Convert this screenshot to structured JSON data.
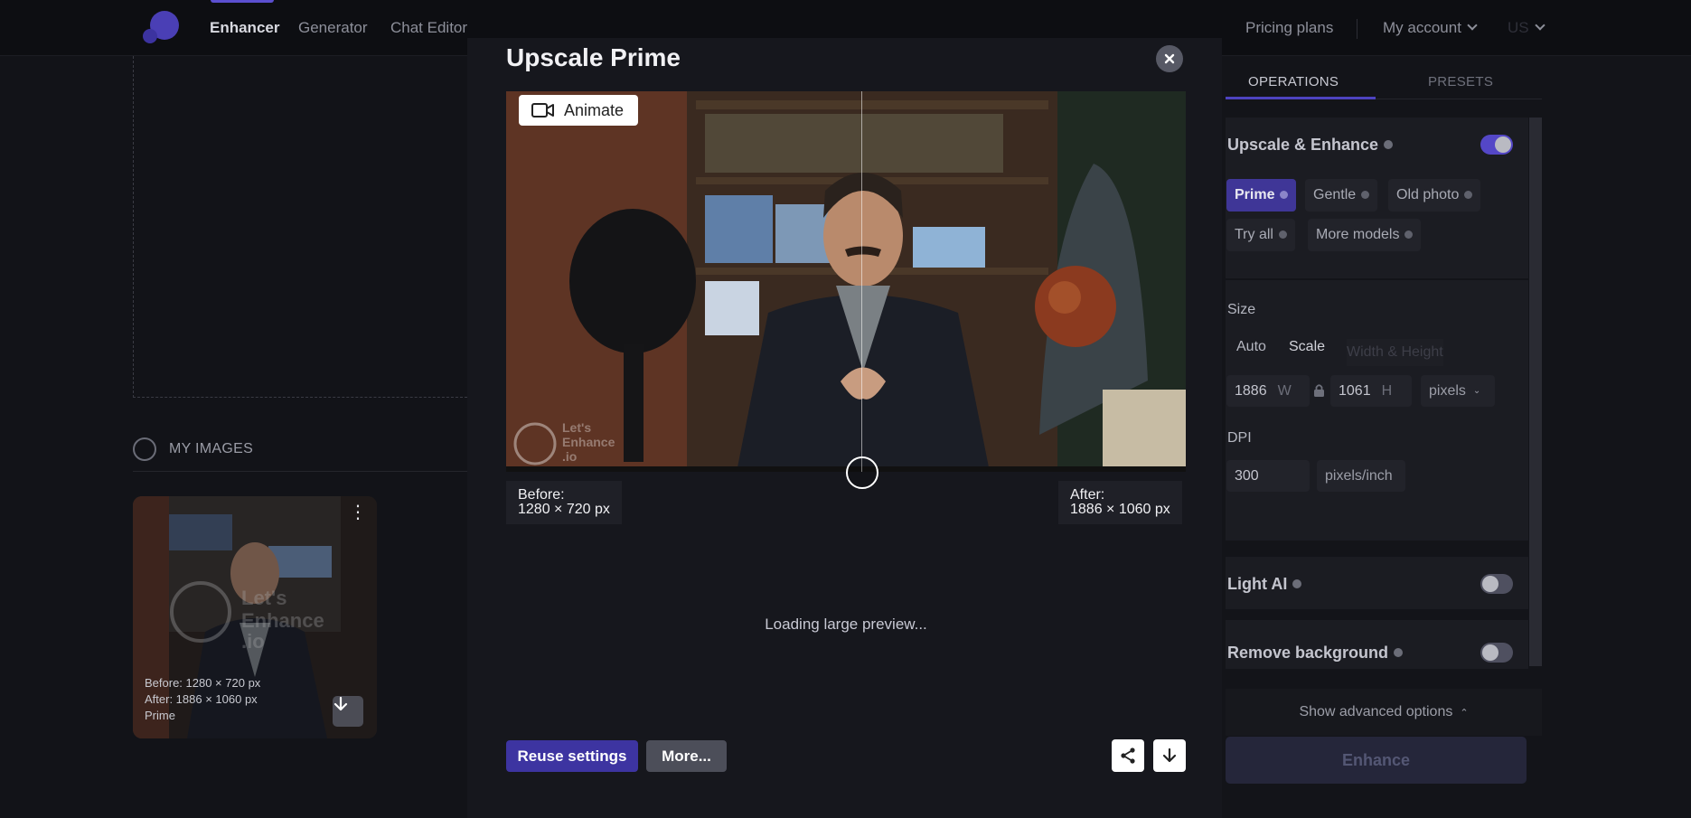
{
  "nav": {
    "items": [
      {
        "label": "Enhancer"
      },
      {
        "label": "Generator"
      },
      {
        "label": "Chat Editor"
      }
    ],
    "pricing": "Pricing plans",
    "account": "My account",
    "lang": "US"
  },
  "sidebar": {
    "my_images": "MY IMAGES",
    "thumb": {
      "before": "Before: 1280 × 720 px",
      "after": "After:   1886 × 1060 px",
      "model": "Prime"
    }
  },
  "modal": {
    "title": "Upscale Prime",
    "animate": "Animate",
    "watermark_l1": "Let's",
    "watermark_l2": "Enhance",
    "watermark_l3": ".io",
    "before_label": "Before:",
    "before_dims": "1280 × 720 px",
    "after_label": "After:",
    "after_dims": "1886 × 1060 px",
    "loading": "Loading large preview...",
    "reuse": "Reuse settings",
    "more": "More..."
  },
  "panel": {
    "tabs": [
      {
        "label": "OPERATIONS"
      },
      {
        "label": "PRESETS"
      }
    ],
    "upscale": {
      "title": "Upscale & Enhance",
      "enabled": true,
      "models": [
        {
          "label": "Prime",
          "active": true
        },
        {
          "label": "Gentle",
          "active": false
        },
        {
          "label": "Old photo",
          "active": false
        },
        {
          "label": "Try all",
          "active": false
        },
        {
          "label": "More models",
          "active": false
        }
      ]
    },
    "size": {
      "label": "Size",
      "options": [
        {
          "label": "Auto"
        },
        {
          "label": "Scale"
        },
        {
          "label": "Width & Height"
        }
      ],
      "width": "1886",
      "width_unit": "W",
      "height": "1061",
      "height_unit": "H",
      "units": "pixels"
    },
    "dpi": {
      "label": "DPI",
      "value": "300",
      "unit": "pixels/inch"
    },
    "light_ai": {
      "title": "Light AI",
      "enabled": false
    },
    "remove_bg": {
      "title": "Remove background",
      "enabled": false
    },
    "advanced": "Show advanced options",
    "enhance": "Enhance"
  },
  "colors": {
    "accent": "#5447c7",
    "background": "#121318",
    "panel": "#1b1c22"
  }
}
